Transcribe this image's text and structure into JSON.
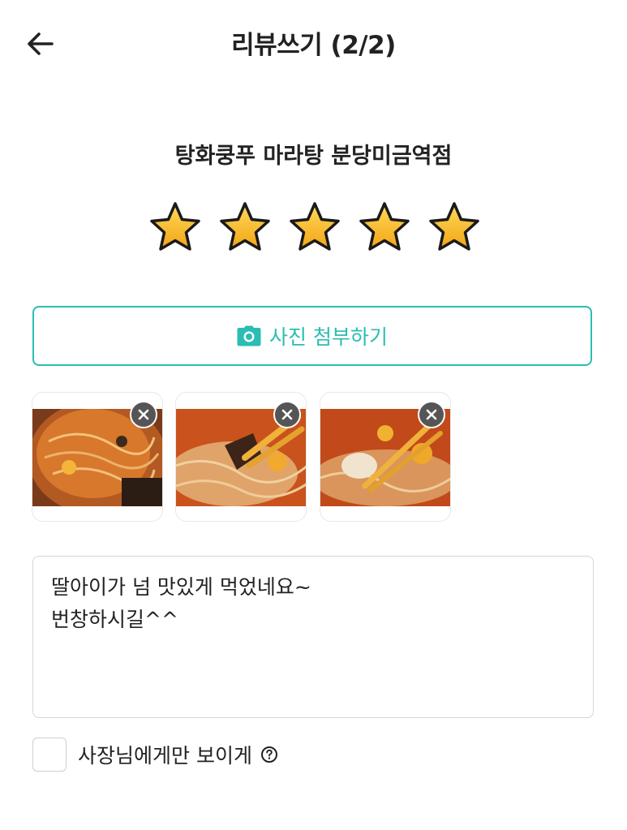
{
  "header": {
    "title": "리뷰쓰기 (2/2)",
    "back_icon": "arrow-left-icon"
  },
  "store": {
    "name": "탕화쿵푸 마라탕 분당미금역점"
  },
  "rating": {
    "value": 5,
    "max": 5,
    "icon": "star-icon",
    "color": "#f6b81e"
  },
  "attach": {
    "label": "사진 첨부하기",
    "icon": "camera-icon",
    "accent": "#2bbdb3"
  },
  "photos": [
    {
      "name": "mala-soup-photo-1",
      "remove_icon": "close-icon"
    },
    {
      "name": "mala-soup-photo-2",
      "remove_icon": "close-icon"
    },
    {
      "name": "mala-soup-photo-3",
      "remove_icon": "close-icon"
    }
  ],
  "review": {
    "lines": [
      "딸아이가 넘 맛있게 먹었네요~",
      "번창하시길^^"
    ]
  },
  "owner_only": {
    "label": "사장님에게만 보이게",
    "checked": false,
    "help_icon": "question-circle-icon"
  }
}
